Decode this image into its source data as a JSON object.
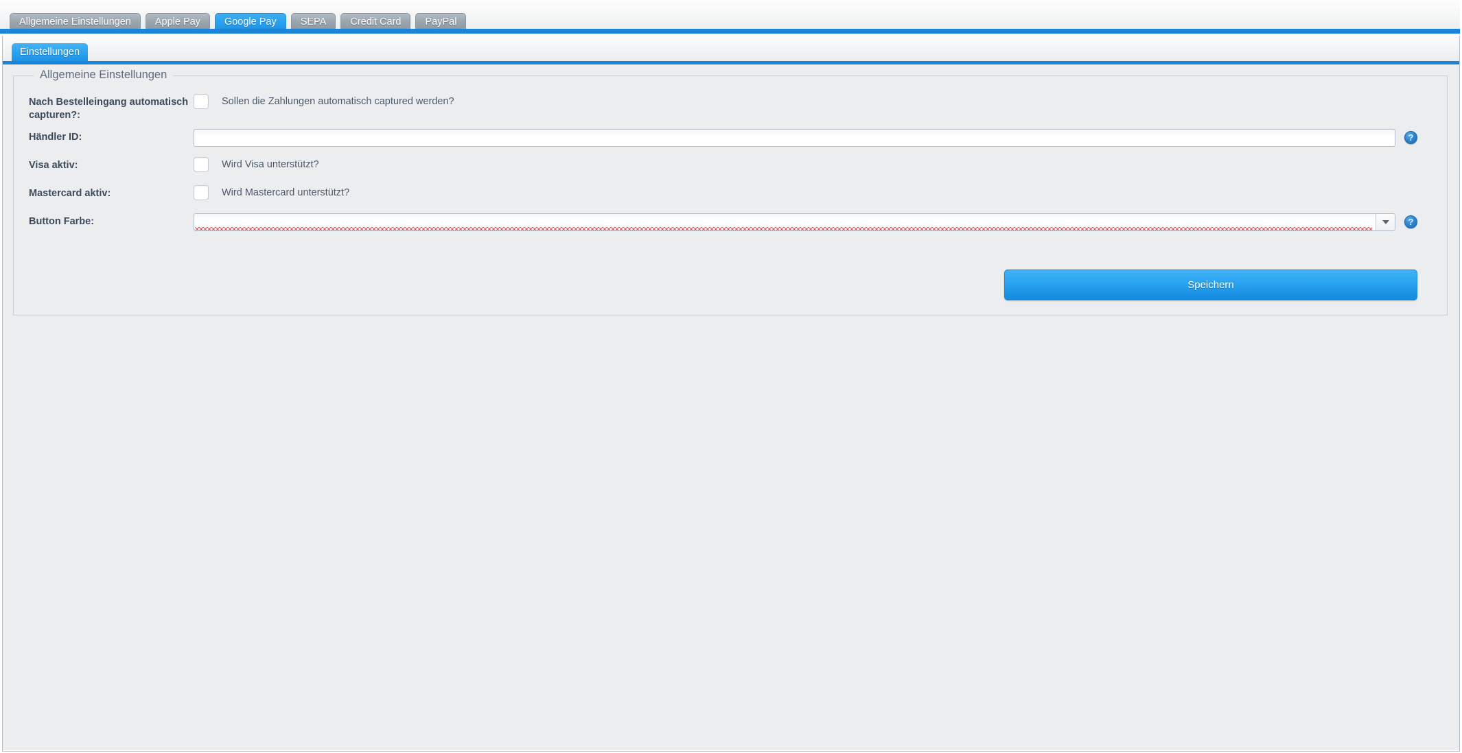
{
  "outer_tabs": [
    {
      "label": "Allgemeine Einstellungen",
      "active": false
    },
    {
      "label": "Apple Pay",
      "active": false
    },
    {
      "label": "Google Pay",
      "active": true
    },
    {
      "label": "SEPA",
      "active": false
    },
    {
      "label": "Credit Card",
      "active": false
    },
    {
      "label": "PayPal",
      "active": false
    }
  ],
  "inner_tabs": [
    {
      "label": "Einstellungen",
      "active": true
    }
  ],
  "fieldset": {
    "legend": "Allgemeine Einstellungen"
  },
  "rows": {
    "auto_capture": {
      "label": "Nach Bestelleingang automatisch capturen?:",
      "hint": "Sollen die Zahlungen automatisch captured werden?",
      "checked": false
    },
    "merchant_id": {
      "label": "Händler ID:",
      "value": "",
      "placeholder": "",
      "help": "?"
    },
    "visa_active": {
      "label": "Visa aktiv:",
      "hint": "Wird Visa unterstützt?",
      "checked": false
    },
    "mastercard_active": {
      "label": "Mastercard aktiv:",
      "hint": "Wird Mastercard unterstützt?",
      "checked": false
    },
    "button_color": {
      "label": "Button Farbe:",
      "value": "",
      "has_error": true,
      "help": "?"
    }
  },
  "actions": {
    "save_label": "Speichern"
  },
  "colors": {
    "accent": "#1c84d6",
    "tab_active": "#2ba3ef",
    "tab_inactive": "#9aa5ae",
    "panel_bg": "#ebedef",
    "label_text": "#3e4a5c",
    "hint_text": "#4e5a6b",
    "error": "#e8434b",
    "help_icon": "#2a83cf"
  }
}
